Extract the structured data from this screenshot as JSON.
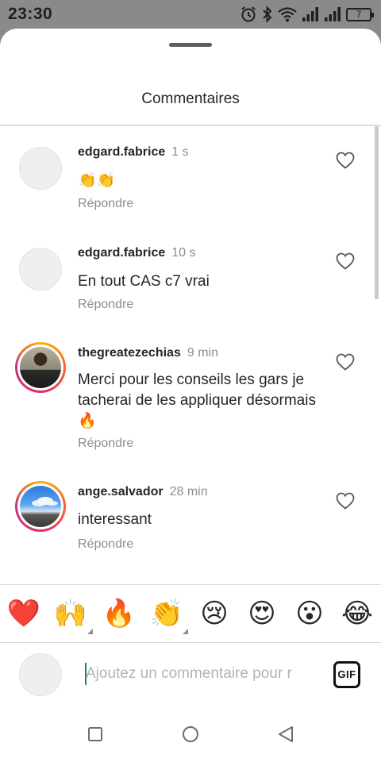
{
  "status_bar": {
    "time": "23:30",
    "battery_level": "7",
    "icons": [
      "alarm-icon",
      "bluetooth-icon",
      "wifi-icon",
      "signal-icon",
      "signal-icon",
      "battery-icon"
    ]
  },
  "sheet": {
    "title": "Commentaires"
  },
  "comments": [
    {
      "username": "edgard.fabrice",
      "time": "1 s",
      "text": "👏👏",
      "reply_label": "Répondre",
      "avatar": "placeholder",
      "story_ring": false
    },
    {
      "username": "edgard.fabrice",
      "time": "10 s",
      "text": "En tout CAS c7 vrai",
      "reply_label": "Répondre",
      "avatar": "placeholder",
      "story_ring": false
    },
    {
      "username": "thegreatezechias",
      "time": "9 min",
      "text": "Merci pour les conseils les gars je tacherai de les appliquer désormais 🔥",
      "reply_label": "Répondre",
      "avatar": "photo-person",
      "story_ring": true
    },
    {
      "username": "ange.salvador",
      "time": "28 min",
      "text": "interessant",
      "reply_label": "Répondre",
      "avatar": "photo-sky",
      "story_ring": true
    }
  ],
  "emoji_bar": [
    "❤️",
    "🙌",
    "🔥",
    "👏",
    "😢",
    "😍",
    "😮",
    "😂"
  ],
  "composer": {
    "placeholder": "Ajoutez un commentaire pour r",
    "value": "",
    "gif_label": "GIF"
  },
  "nav_bar": [
    "square-recents-icon",
    "circle-home-icon",
    "triangle-back-icon"
  ],
  "colors": {
    "status_bar_bg": "#8a8a8a",
    "secondary_text": "#8e8e8e",
    "primary_text": "#262626",
    "caret": "#0a8b7a"
  }
}
